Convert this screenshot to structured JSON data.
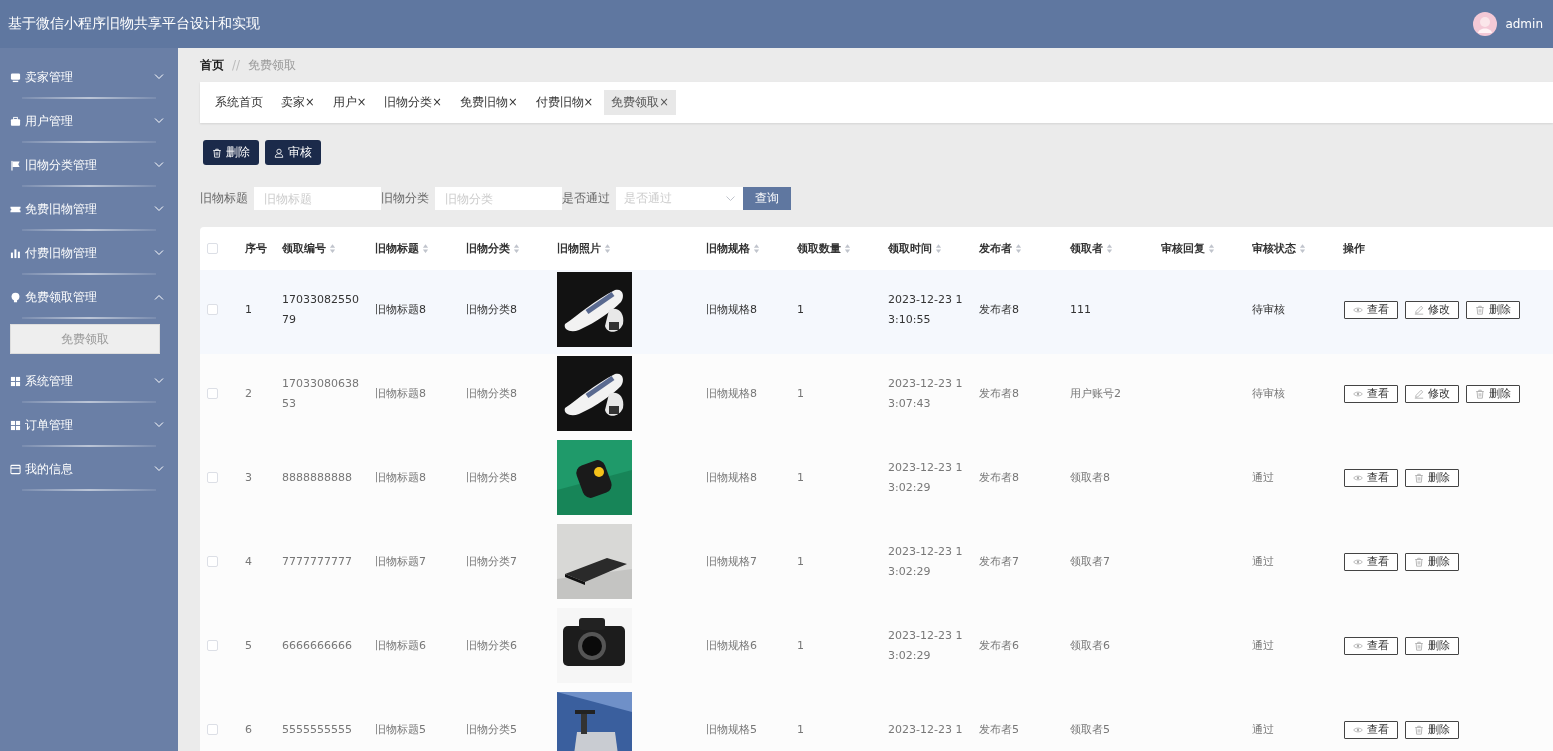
{
  "header": {
    "title": "基于微信小程序旧物共享平台设计和实现",
    "user": "admin"
  },
  "sidebar": {
    "items": [
      {
        "label": "卖家管理",
        "kind": "monitor",
        "expanded": false
      },
      {
        "label": "用户管理",
        "kind": "briefcase",
        "expanded": false
      },
      {
        "label": "旧物分类管理",
        "kind": "flag",
        "expanded": false
      },
      {
        "label": "免费旧物管理",
        "kind": "ticket",
        "expanded": false
      },
      {
        "label": "付费旧物管理",
        "kind": "chart",
        "expanded": false
      },
      {
        "label": "免费领取管理",
        "kind": "bulb",
        "expanded": true,
        "children": [
          {
            "label": "免费领取",
            "selected": true
          }
        ]
      },
      {
        "label": "系统管理",
        "kind": "grid",
        "expanded": false
      },
      {
        "label": "订单管理",
        "kind": "grid",
        "expanded": false
      },
      {
        "label": "我的信息",
        "kind": "card",
        "expanded": false
      }
    ]
  },
  "breadcrumb": {
    "home": "首页",
    "separator": "//",
    "current": "免费领取"
  },
  "tabs": [
    {
      "label": "系统首页",
      "selected": false
    },
    {
      "label": "卖家",
      "close": "×",
      "selected": false
    },
    {
      "label": "用户",
      "close": "×",
      "selected": false
    },
    {
      "label": "旧物分类",
      "close": "×",
      "selected": false
    },
    {
      "label": "免费旧物",
      "close": "×",
      "selected": false
    },
    {
      "label": "付费旧物",
      "close": "×",
      "selected": false
    },
    {
      "label": "免费领取",
      "close": "×",
      "selected": true
    }
  ],
  "toolbar": [
    {
      "label": "删除",
      "kind": "delete"
    },
    {
      "label": "审核",
      "kind": "audit"
    }
  ],
  "filters": [
    {
      "label": "旧物标题",
      "placeholder": "旧物标题",
      "kind": "text"
    },
    {
      "label": "旧物分类",
      "placeholder": "旧物分类",
      "kind": "text"
    },
    {
      "label": "是否通过",
      "placeholder": "是否通过",
      "kind": "select"
    }
  ],
  "search_button": "查询",
  "table": {
    "all_checked": false,
    "columns": [
      {
        "label": "序号",
        "sortable": false
      },
      {
        "label": "领取编号",
        "sortable": true
      },
      {
        "label": "旧物标题",
        "sortable": true
      },
      {
        "label": "旧物分类",
        "sortable": true
      },
      {
        "label": "旧物照片",
        "sortable": true
      },
      {
        "label": "旧物规格",
        "sortable": true
      },
      {
        "label": "领取数量",
        "sortable": true
      },
      {
        "label": "领取时间",
        "sortable": true
      },
      {
        "label": "发布者",
        "sortable": true
      },
      {
        "label": "领取者",
        "sortable": true
      },
      {
        "label": "审核回复",
        "sortable": true
      },
      {
        "label": "审核状态",
        "sortable": true
      },
      {
        "label": "操作",
        "sortable": false
      }
    ],
    "rows": [
      {
        "hovered": true,
        "checked": false,
        "index": "1",
        "code": "1703308255079",
        "title": "旧物标题8",
        "category": "旧物分类8",
        "photo": {
          "kind": "picture"
        },
        "spec": "旧物规格8",
        "quantity": "1",
        "time": "2023-12-23 13:10:55",
        "publisher": "发布者8",
        "receiver": "111",
        "status": "待审核",
        "actions": [
          {
            "kind": "view",
            "label": "查看"
          },
          {
            "kind": "edit",
            "label": "修改"
          },
          {
            "kind": "delete",
            "label": "删除"
          }
        ]
      },
      {
        "hovered": false,
        "checked": false,
        "index": "2",
        "code": "1703308063853",
        "title": "旧物标题8",
        "category": "旧物分类8",
        "photo": {
          "kind": "picture"
        },
        "spec": "旧物规格8",
        "quantity": "1",
        "time": "2023-12-23 13:07:43",
        "publisher": "发布者8",
        "receiver": "用户账号2",
        "status": "待审核",
        "actions": [
          {
            "kind": "view",
            "label": "查看"
          },
          {
            "kind": "edit",
            "label": "修改"
          },
          {
            "kind": "delete",
            "label": "删除"
          }
        ]
      },
      {
        "hovered": false,
        "checked": false,
        "index": "3",
        "code": "8888888888",
        "title": "旧物标题8",
        "category": "旧物分类8",
        "photo": {
          "kind": "picture"
        },
        "spec": "旧物规格8",
        "quantity": "1",
        "time": "2023-12-23 13:02:29",
        "publisher": "发布者8",
        "receiver": "领取者8",
        "status": "通过",
        "actions": [
          {
            "kind": "view",
            "label": "查看"
          },
          {
            "kind": "delete",
            "label": "删除"
          }
        ]
      },
      {
        "hovered": false,
        "checked": false,
        "index": "4",
        "code": "7777777777",
        "title": "旧物标题7",
        "category": "旧物分类7",
        "photo": {
          "kind": "picture"
        },
        "spec": "旧物规格7",
        "quantity": "1",
        "time": "2023-12-23 13:02:29",
        "publisher": "发布者7",
        "receiver": "领取者7",
        "status": "通过",
        "actions": [
          {
            "kind": "view",
            "label": "查看"
          },
          {
            "kind": "delete",
            "label": "删除"
          }
        ]
      },
      {
        "hovered": false,
        "checked": false,
        "index": "5",
        "code": "6666666666",
        "title": "旧物标题6",
        "category": "旧物分类6",
        "photo": {
          "kind": "picture"
        },
        "spec": "旧物规格6",
        "quantity": "1",
        "time": "2023-12-23 13:02:29",
        "publisher": "发布者6",
        "receiver": "领取者6",
        "status": "通过",
        "actions": [
          {
            "kind": "view",
            "label": "查看"
          },
          {
            "kind": "delete",
            "label": "删除"
          }
        ]
      },
      {
        "hovered": false,
        "checked": false,
        "index": "6",
        "code": "5555555555",
        "title": "旧物标题5",
        "category": "旧物分类5",
        "photo": {
          "kind": "picture"
        },
        "spec": "旧物规格5",
        "quantity": "1",
        "time": "2023-12-23 1",
        "publisher": "发布者5",
        "receiver": "领取者5",
        "status": "通过",
        "actions": [
          {
            "kind": "view",
            "label": "查看"
          },
          {
            "kind": "delete",
            "label": "删除"
          }
        ]
      }
    ]
  }
}
